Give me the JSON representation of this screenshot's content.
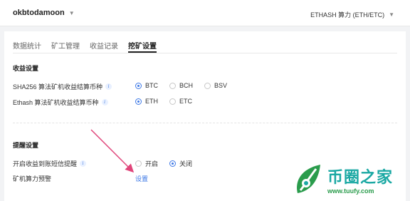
{
  "topbar": {
    "account": "okbtodamoon",
    "algorithm": "ETHASH 算力 (ETH/ETC)"
  },
  "tabs": [
    {
      "label": "数据统计",
      "active": false
    },
    {
      "label": "矿工管理",
      "active": false
    },
    {
      "label": "收益记录",
      "active": false
    },
    {
      "label": "挖矿设置",
      "active": true
    }
  ],
  "income": {
    "title": "收益设置",
    "sha256_label": "SHA256 算法矿机收益结算币种",
    "sha256_options": [
      "BTC",
      "BCH",
      "BSV"
    ],
    "sha256_selected": "BTC",
    "ethash_label": "Ethash 算法矿机收益结算币种",
    "ethash_options": [
      "ETH",
      "ETC"
    ],
    "ethash_selected": "ETH"
  },
  "alerts": {
    "title": "提醒设置",
    "sms_label": "开启收益到账短信提醒",
    "sms_on": "开启",
    "sms_off": "关闭",
    "sms_selected": "关闭",
    "hashrate_label": "矿机算力预警",
    "hashrate_link": "设置"
  },
  "watermark": {
    "title": "币圈之家",
    "url": "www.tuufy.com"
  },
  "colors": {
    "accent": "#3d78e6",
    "annotation_arrow": "#e0457a",
    "watermark_teal": "#1aa8a3",
    "watermark_green": "#2a9c4c"
  }
}
